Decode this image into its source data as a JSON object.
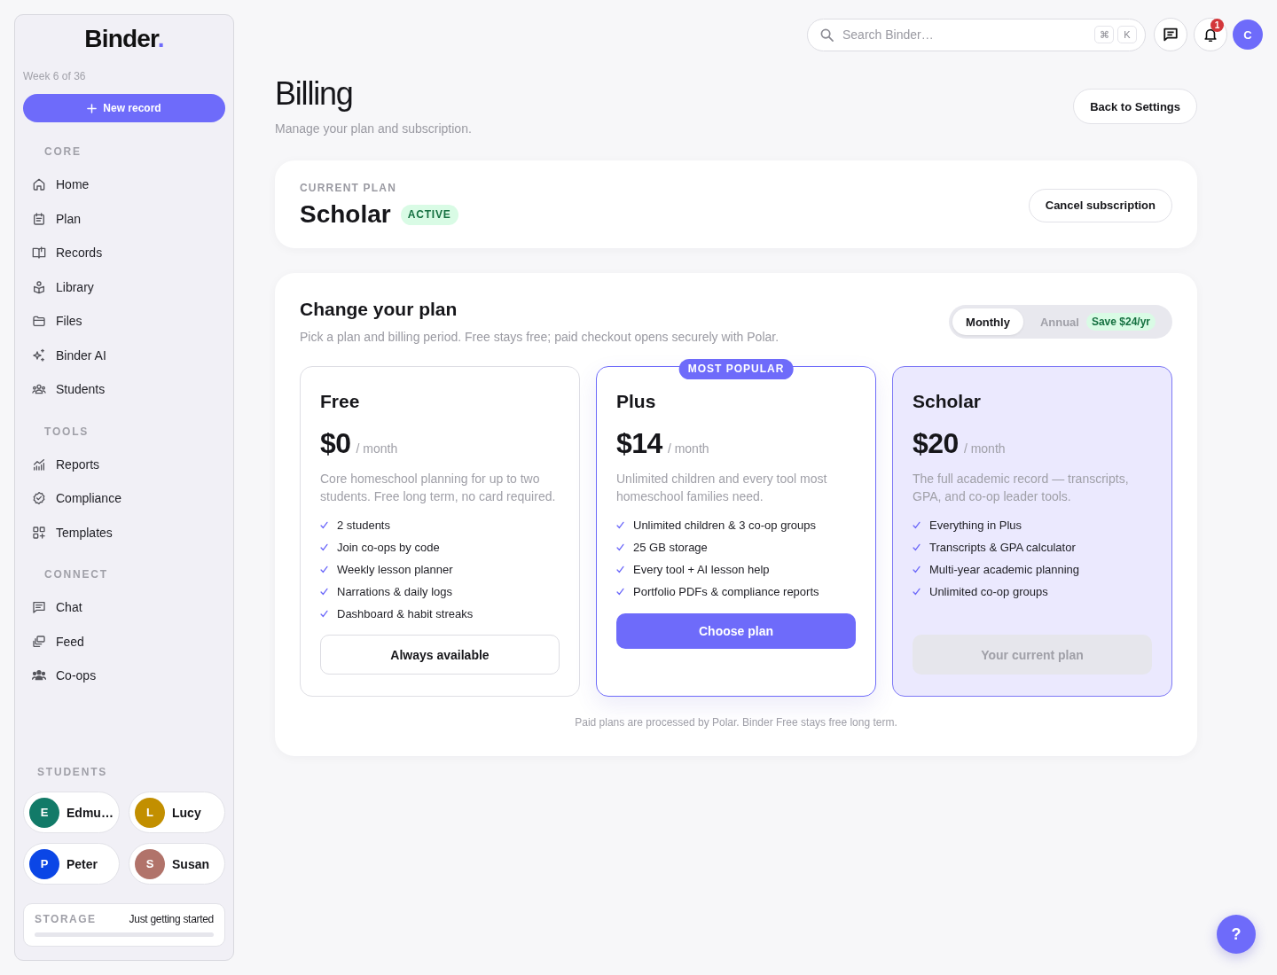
{
  "sidebar": {
    "logo": {
      "text": "Binder",
      "accent": "."
    },
    "week": "Week 6 of 36",
    "new_button": "New record",
    "sections": [
      {
        "title": "CORE",
        "items": [
          {
            "label": "Home"
          },
          {
            "label": "Plan"
          },
          {
            "label": "Records"
          },
          {
            "label": "Library"
          },
          {
            "label": "Files"
          },
          {
            "label": "Binder AI"
          },
          {
            "label": "Students"
          }
        ]
      },
      {
        "title": "TOOLS",
        "items": [
          {
            "label": "Reports"
          },
          {
            "label": "Compliance"
          },
          {
            "label": "Templates"
          }
        ]
      },
      {
        "title": "CONNECT",
        "items": [
          {
            "label": "Chat"
          },
          {
            "label": "Feed"
          },
          {
            "label": "Co-ops"
          }
        ]
      }
    ],
    "students": {
      "title": "STUDENTS",
      "items": [
        {
          "initial": "E",
          "name": "Edmu…",
          "color": "#127a68"
        },
        {
          "initial": "L",
          "name": "Lucy",
          "color": "#c28f00"
        },
        {
          "initial": "P",
          "name": "Peter",
          "color": "#0b46e6"
        },
        {
          "initial": "S",
          "name": "Susan",
          "color": "#b1736a"
        }
      ]
    },
    "storage": {
      "label": "STORAGE",
      "status": "Just getting started",
      "level": 0
    }
  },
  "top_bar": {
    "search": {
      "placeholder": "Search Binder…",
      "keys": [
        "⌘",
        "K"
      ]
    },
    "notification_count": "1",
    "avatar": "C"
  },
  "header": {
    "title": "Billing",
    "subtitle": "Manage your plan and subscription.",
    "back_button": "Back to Settings"
  },
  "current_plan": {
    "label": "CURRENT PLAN",
    "name": "Scholar",
    "status": "ACTIVE",
    "cancel_button": "Cancel subscription"
  },
  "change_plan": {
    "title": "Change your plan",
    "subtitle": "Pick a plan and billing period. Free stays free; paid checkout opens securely with Polar.",
    "billing_period": [
      {
        "label": "Monthly",
        "selected": true
      },
      {
        "label": "Annual",
        "selected": false,
        "badge": "Save $24/yr"
      }
    ],
    "plans": [
      {
        "name": "Free",
        "price": "$0",
        "period": "/ month",
        "description": "Core homeschool planning for up to two students. Free long term, no card required.",
        "features": [
          "2 students",
          "Join co-ops by code",
          "Weekly lesson planner",
          "Narrations & daily logs",
          "Dashboard & habit streaks"
        ],
        "button": {
          "label": "Always available",
          "kind": "outline"
        },
        "featured": false,
        "current": false
      },
      {
        "name": "Plus",
        "badge": "MOST POPULAR",
        "price": "$14",
        "period": "/ month",
        "description": "Unlimited children and every tool most homeschool families need.",
        "features": [
          "Unlimited children & 3 co-op groups",
          "25 GB storage",
          "Every tool + AI lesson help",
          "Portfolio PDFs & compliance reports"
        ],
        "button": {
          "label": "Choose plan",
          "kind": "primary"
        },
        "featured": true,
        "current": false
      },
      {
        "name": "Scholar",
        "price": "$20",
        "period": "/ month",
        "description": "The full academic record — transcripts, GPA, and co-op leader tools.",
        "features": [
          "Everything in Plus",
          "Transcripts & GPA calculator",
          "Multi-year academic planning",
          "Unlimited co-op groups"
        ],
        "button": {
          "label": "Your current plan",
          "kind": "current"
        },
        "featured": false,
        "current": true
      }
    ],
    "footnote": "Paid plans are processed by Polar. Binder Free stays free long term."
  },
  "help_button": "?"
}
